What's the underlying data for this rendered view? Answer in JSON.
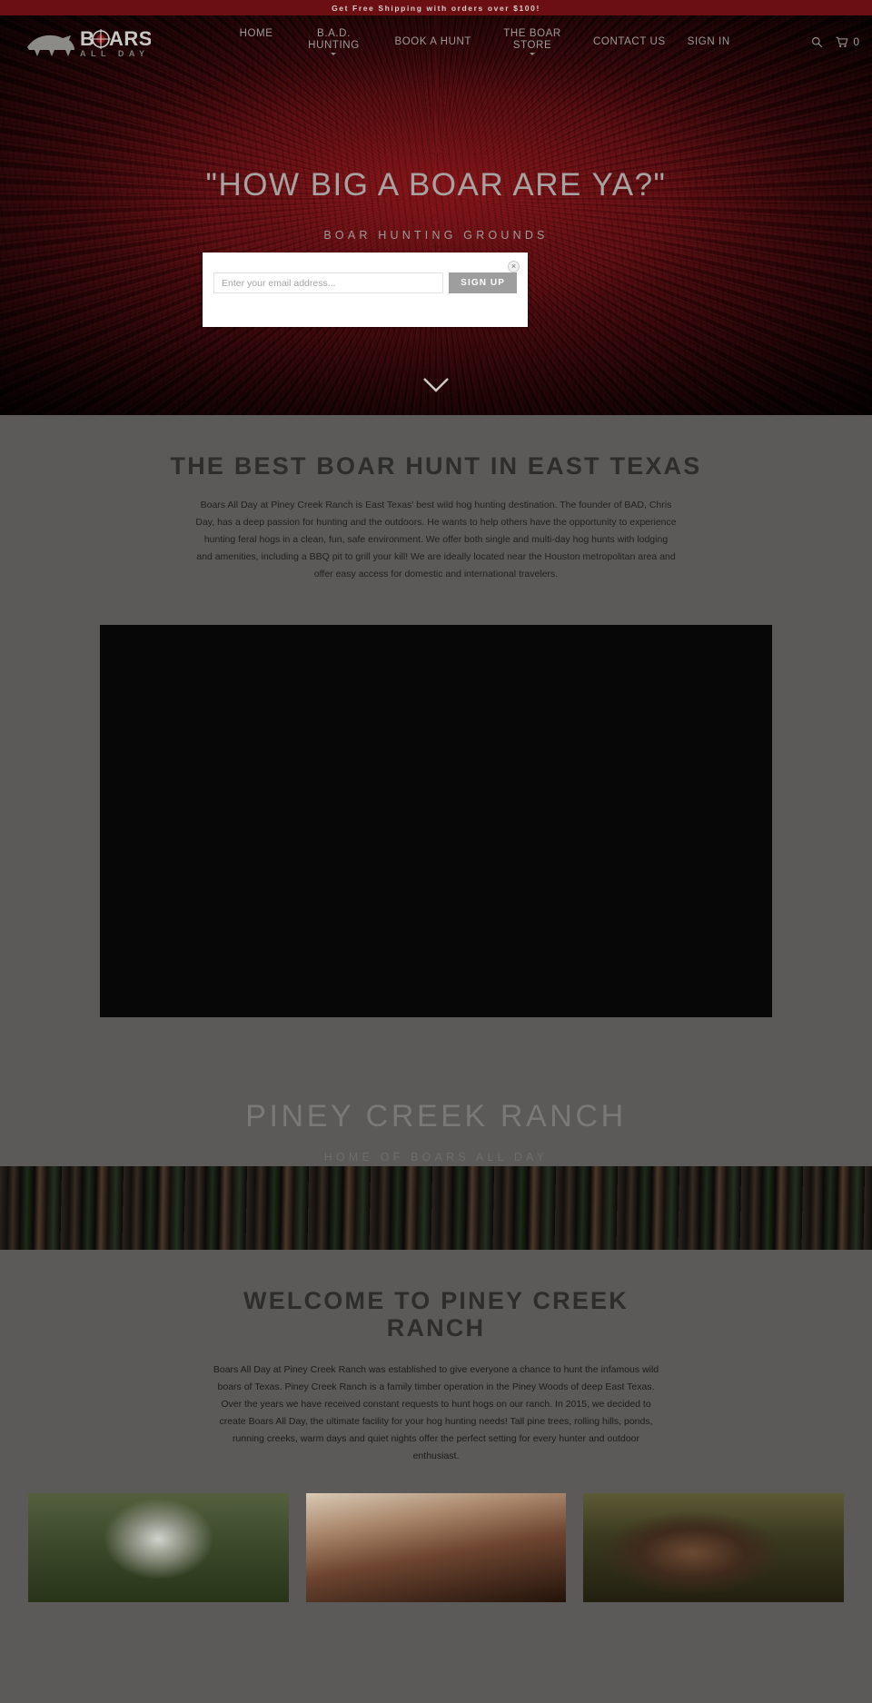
{
  "announcement": {
    "text": "Get Free Shipping with orders over $100!"
  },
  "header": {
    "logo": {
      "brand": "BOARS",
      "tagline": "ALL DAY",
      "icon": "boar-logo-icon"
    },
    "nav": [
      {
        "label": "HOME",
        "has_dropdown": false
      },
      {
        "label": "B.A.D. HUNTING",
        "has_dropdown": true
      },
      {
        "label": "BOOK A HUNT",
        "has_dropdown": false
      },
      {
        "label": "THE BOAR STORE",
        "has_dropdown": true
      },
      {
        "label": "CONTACT US",
        "has_dropdown": false
      },
      {
        "label": "SIGN IN",
        "has_dropdown": false
      }
    ],
    "search_icon": "search-icon",
    "cart_icon": "cart-icon",
    "cart_count": "0"
  },
  "hero": {
    "title": "\"HOW BIG A BOAR ARE YA?\"",
    "subtitle": "BOAR HUNTING GROUNDS",
    "scroll_icon": "chevron-down-icon"
  },
  "newsletter_modal": {
    "close_label": "×",
    "email_placeholder": "Enter your email address...",
    "email_value": "",
    "submit_label": "SIGN UP"
  },
  "intro": {
    "heading": "THE BEST BOAR HUNT IN EAST TEXAS",
    "body": "Boars All Day at Piney Creek Ranch is East Texas' best wild hog hunting destination. The founder of BAD, Chris Day, has a deep passion for hunting and the outdoors.  He wants to help others have the opportunity to experience hunting feral hogs in a clean, fun, safe environment. We offer both single and multi-day hog hunts with lodging and amenities, including a BBQ pit to grill your kill! We are ideally located near the Houston metropolitan area and offer easy access for domestic and international travelers.",
    "video_label": "embedded-video"
  },
  "ranch_banner": {
    "title": "PINEY CREEK RANCH",
    "subtitle": "HOME OF BOARS ALL DAY"
  },
  "welcome": {
    "heading": "WELCOME TO PINEY CREEK RANCH",
    "body": "Boars All Day at Piney Creek Ranch was established to give everyone a chance to hunt the infamous wild boars of Texas. Piney Creek Ranch is a family timber operation in the Piney Woods of deep East Texas. Over the years we have received constant requests to hunt hogs on our ranch. In 2015, we decided to create Boars All Day, the ultimate facility for your hog hunting needs! Tall pine trees, rolling hills, ponds, running creeks, warm days and quiet nights offer the perfect setting for every hunter and outdoor enthusiast.",
    "cards": [
      {
        "name": "hunter-portrait-photo"
      },
      {
        "name": "rifle-aiming-photo"
      },
      {
        "name": "wild-boar-photo"
      }
    ]
  },
  "colors": {
    "announcement_bg": "#6b0f12",
    "page_bg": "#5b5a58",
    "hero_dark_red": "#3a070a",
    "heading_text": "#2d2d2d",
    "muted_text": "#9e9a99",
    "button_gray": "#9e9e9e"
  }
}
